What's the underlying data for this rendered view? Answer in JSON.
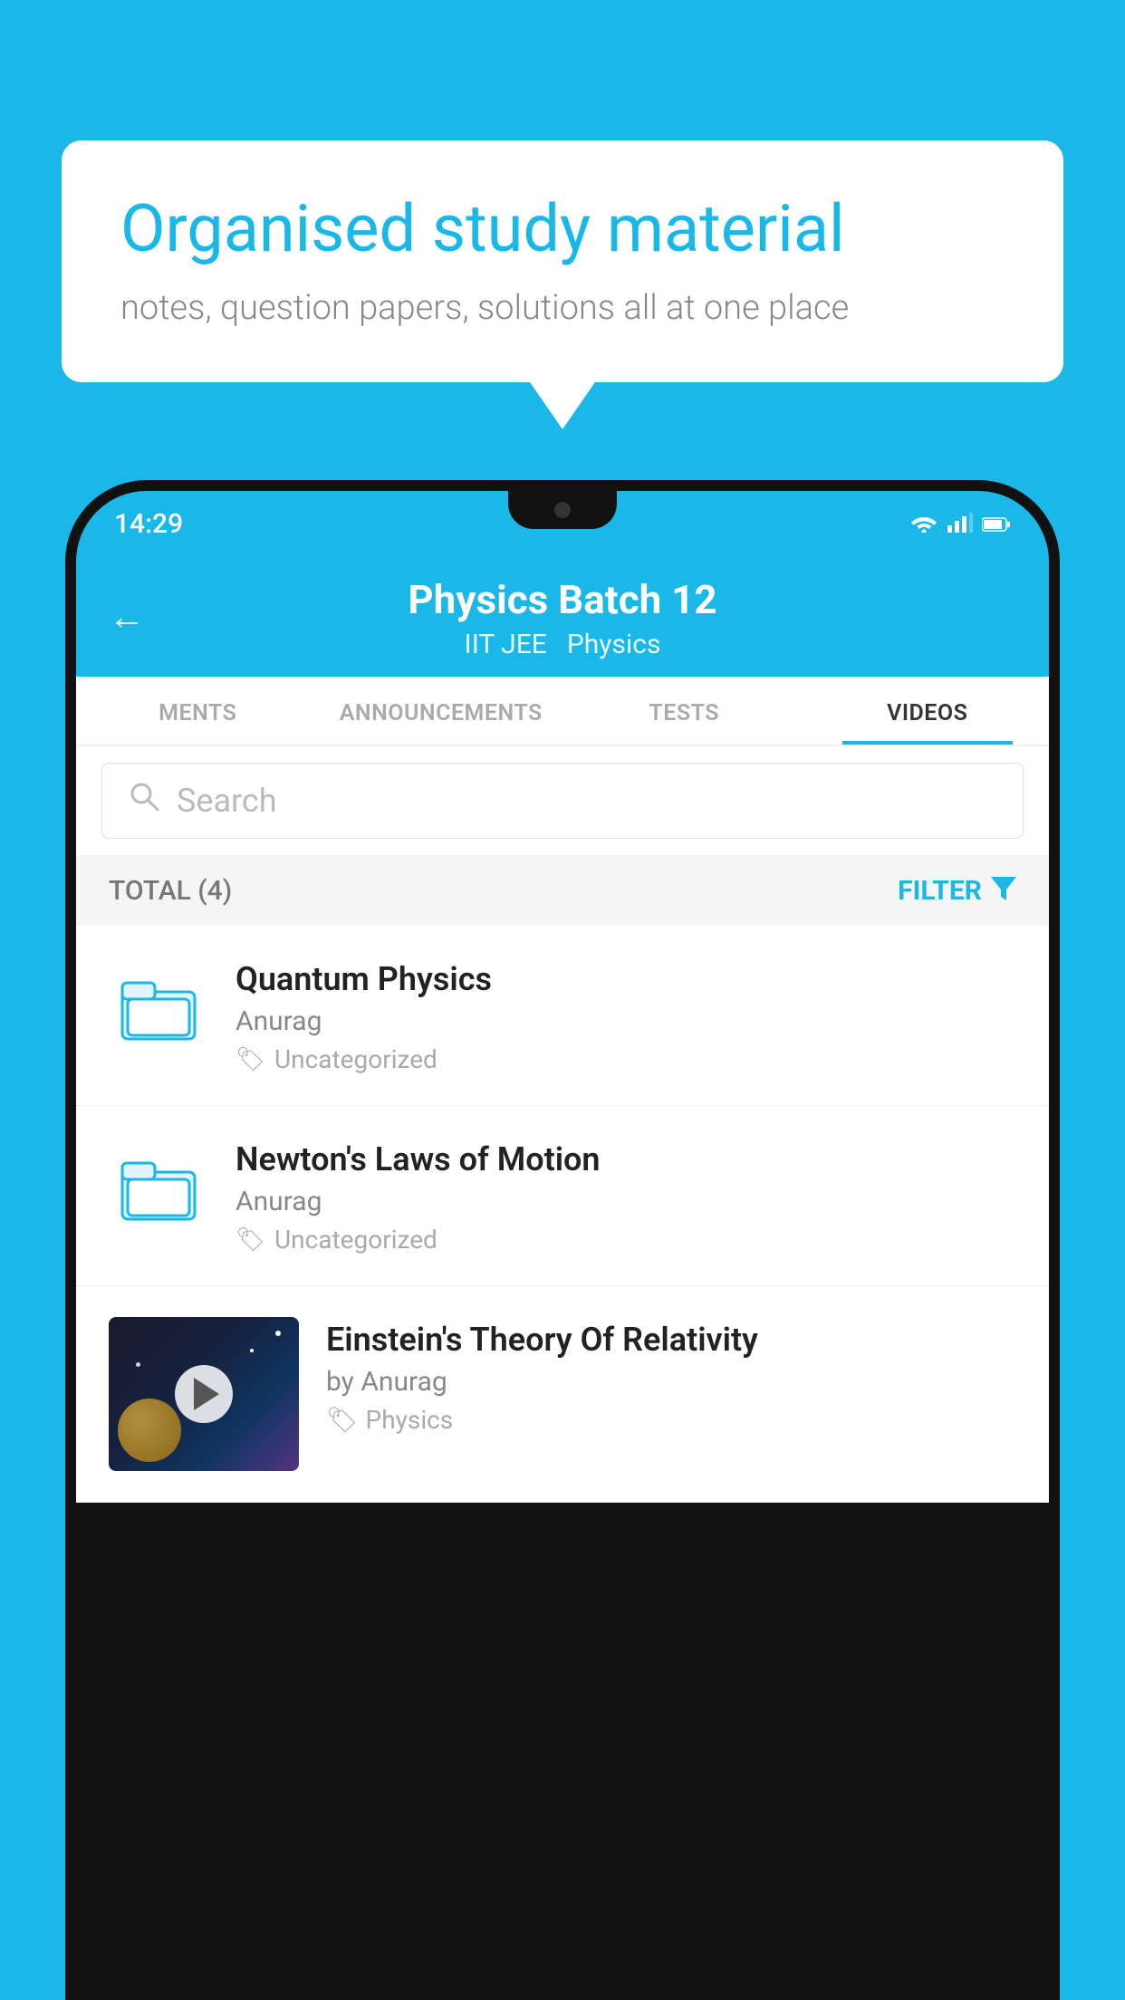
{
  "background_color": "#1ab8e8",
  "speech_bubble": {
    "title": "Organised study material",
    "subtitle": "notes, question papers, solutions all at one place"
  },
  "status_bar": {
    "time": "14:29",
    "icons": [
      "wifi",
      "signal",
      "battery"
    ]
  },
  "app_header": {
    "title": "Physics Batch 12",
    "tags": [
      "IIT JEE",
      "Physics"
    ],
    "back_label": "←"
  },
  "tabs": [
    {
      "label": "MENTS",
      "active": false
    },
    {
      "label": "ANNOUNCEMENTS",
      "active": false
    },
    {
      "label": "TESTS",
      "active": false
    },
    {
      "label": "VIDEOS",
      "active": true
    }
  ],
  "search": {
    "placeholder": "Search"
  },
  "filter_bar": {
    "total_label": "TOTAL (4)",
    "filter_label": "FILTER"
  },
  "video_items": [
    {
      "title": "Quantum Physics",
      "author": "Anurag",
      "tag": "Uncategorized",
      "type": "folder"
    },
    {
      "title": "Newton's Laws of Motion",
      "author": "Anurag",
      "tag": "Uncategorized",
      "type": "folder"
    },
    {
      "title": "Einstein's Theory Of Relativity",
      "author": "by Anurag",
      "tag": "Physics",
      "type": "video"
    }
  ]
}
